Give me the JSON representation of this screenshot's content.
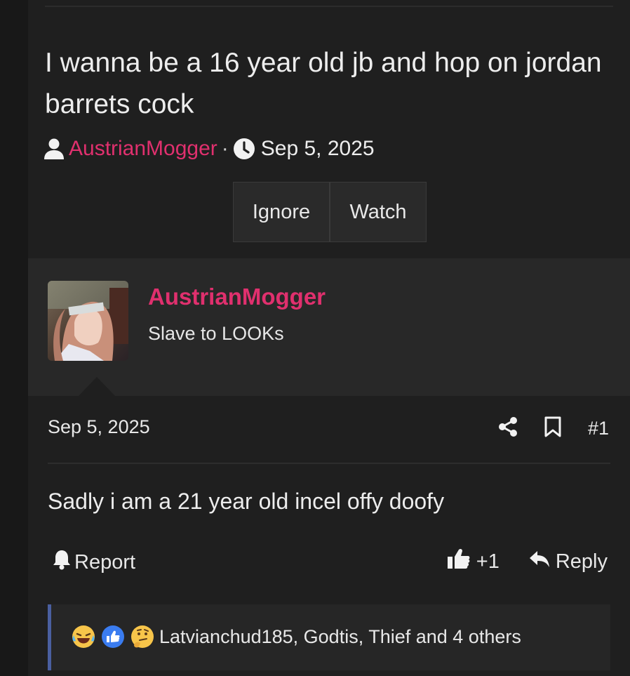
{
  "thread": {
    "title": "I wanna be a 16 year old jb and hop on jordan barrets cock",
    "author": "AustrianMogger",
    "separator": "·",
    "date": "Sep 5, 2025",
    "buttons": {
      "ignore": "Ignore",
      "watch": "Watch"
    }
  },
  "post": {
    "user": {
      "name": "AustrianMogger",
      "title": "Slave to LOOKs"
    },
    "date": "Sep 5, 2025",
    "number": "#1",
    "text": "Sadly i am a 21 year old incel offy doofy",
    "report_label": "Report",
    "like_count": "+1",
    "reply_label": "Reply",
    "reactions_text": "Latvianchud185, Godtis, Thief and 4 others"
  },
  "icons": {
    "user": "user-icon",
    "clock": "clock-icon",
    "share": "share-icon",
    "bookmark": "bookmark-icon",
    "bell": "bell-icon",
    "thumbs_up": "thumbs-up-icon",
    "reply": "reply-icon"
  },
  "colors": {
    "accent_username": "#e0306e",
    "reaction_bar": "#4a5fa0",
    "background": "#1b1b1b"
  }
}
